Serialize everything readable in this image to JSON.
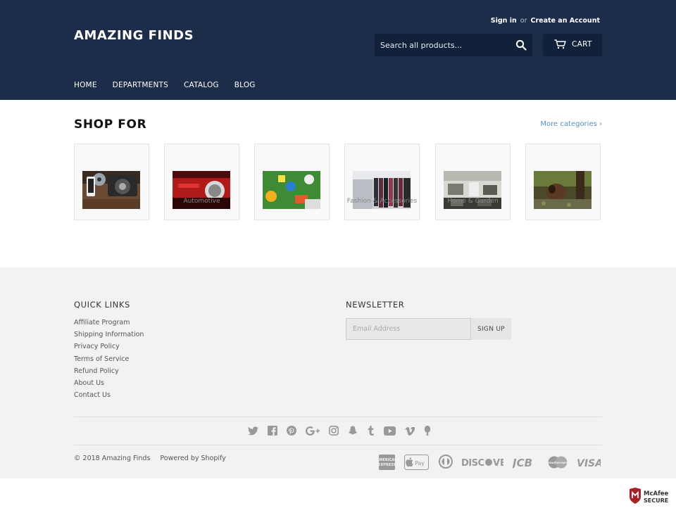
{
  "header": {
    "logo": "AMAZING FINDS",
    "sign_in": "Sign in",
    "or": "or",
    "create_account": "Create an Account",
    "search_placeholder": "Search all products...",
    "cart_label": "CART",
    "nav": [
      "HOME",
      "DEPARTMENTS",
      "CATALOG",
      "BLOG"
    ]
  },
  "shop": {
    "title": "SHOP FOR",
    "more": "More categories ›",
    "categories": [
      {
        "label": "",
        "icon": "electronics-image"
      },
      {
        "label": "Automotive",
        "icon": "automotive-image"
      },
      {
        "label": "",
        "icon": "toys-image"
      },
      {
        "label": "Fashion & Accessories",
        "icon": "fashion-image"
      },
      {
        "label": "Home & Garden",
        "icon": "home-image"
      },
      {
        "label": "",
        "icon": "pets-image"
      }
    ]
  },
  "footer": {
    "quick_links_title": "QUICK LINKS",
    "links": [
      "Affiliate Program",
      "Shipping Information",
      "Privacy Policy",
      "Terms of Service",
      "Refund Policy",
      "About Us",
      "Contact Us"
    ],
    "newsletter_title": "NEWSLETTER",
    "email_placeholder": "Email Address",
    "signup_label": "SIGN UP",
    "social_icons": [
      "twitter-icon",
      "facebook-icon",
      "pinterest-icon",
      "google-plus-icon",
      "instagram-icon",
      "snapchat-icon",
      "tumblr-icon",
      "youtube-icon",
      "vimeo-icon",
      "fancy-icon"
    ],
    "copyright": "© 2018 Amazing Finds",
    "powered": "Powered by Shopify",
    "payments": [
      "AMERICAN EXPRESS",
      "Pay",
      "Discover",
      "JCB",
      "mastercard",
      "VISA"
    ],
    "mcafee": "McAfee SECURE"
  },
  "colors": {
    "header_bg": "#1c2d4a",
    "link_blue": "#5d8dbd",
    "footer_bg": "#f2f2f2"
  }
}
